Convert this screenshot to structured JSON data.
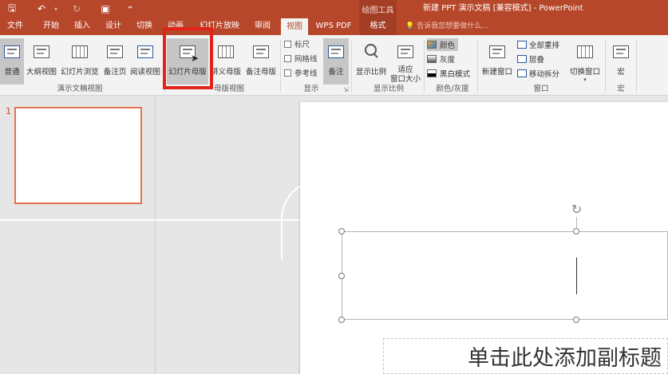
{
  "window": {
    "context_tools": "绘图工具",
    "doc_title": "新建 PPT 演示文稿 [兼容模式] - PowerPoint"
  },
  "qat": [
    {
      "icon": "save-icon",
      "glyph": "🖫"
    },
    {
      "icon": "undo-icon",
      "glyph": "↶"
    },
    {
      "icon": "undo-dropdown-icon",
      "glyph": "▾"
    },
    {
      "icon": "redo-icon",
      "glyph": "↻"
    },
    {
      "icon": "present-icon",
      "glyph": "▣"
    },
    {
      "icon": "customize-qat-icon",
      "glyph": "⁼"
    }
  ],
  "tabs": [
    "文件",
    "开始",
    "插入",
    "设计",
    "切换",
    "动画",
    "幻灯片放映",
    "审阅",
    "视图",
    "WPS PDF",
    "格式"
  ],
  "active_tab": "视图",
  "tell_me": "告诉我您想要做什么...",
  "ribbon": {
    "presentation_views": {
      "label": "演示文稿视图",
      "buttons": [
        "普通",
        "大纲视图",
        "幻灯片浏览",
        "备注页",
        "阅读视图"
      ]
    },
    "master_views": {
      "label": "母版视图",
      "buttons": [
        "幻灯片母版",
        "讲义母版",
        "备注母版"
      ]
    },
    "show": {
      "label": "显示",
      "checkboxes": [
        "标尺",
        "网格线",
        "参考线"
      ],
      "notes": "备注"
    },
    "zoom": {
      "label": "显示比例",
      "buttons": [
        "显示比例",
        "适应\n窗口大小"
      ]
    },
    "color": {
      "label": "颜色/灰度",
      "options": [
        "颜色",
        "灰度",
        "黑白模式"
      ]
    },
    "window": {
      "label": "窗口",
      "new_window": "新建窗口",
      "small": [
        "全部重排",
        "层叠",
        "移动拆分"
      ],
      "switch": "切换窗口"
    },
    "macros": {
      "label": "宏",
      "button": "宏"
    }
  },
  "slide_pane": {
    "thumb_number": "1"
  },
  "slide": {
    "subtitle_placeholder": "单击此处添加副标题"
  },
  "colors": {
    "accent": "#b7472a",
    "highlight": "#e2231a",
    "thumb_border": "#e6734f"
  }
}
